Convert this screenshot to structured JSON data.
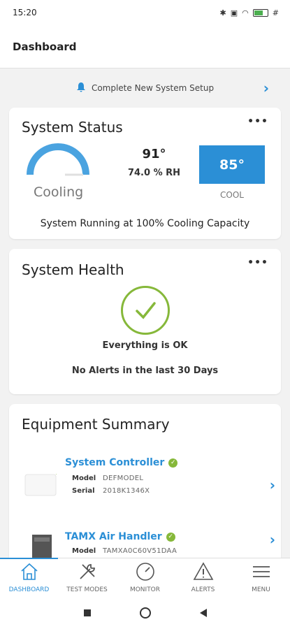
{
  "statusbar": {
    "time": "15:20",
    "battery": "86"
  },
  "appbar": {
    "title": "Dashboard"
  },
  "setup_banner": {
    "label": "Complete New System Setup"
  },
  "status_card": {
    "title": "System Status",
    "gauge_label": "Cooling",
    "indoor_temp": "91°",
    "humidity": "74.0 % RH",
    "setpoint": "85°",
    "mode": "COOL",
    "running_text": "System Running at 100% Cooling Capacity"
  },
  "health_card": {
    "title": "System Health",
    "status": "Everything is OK",
    "alerts": "No Alerts in the last 30 Days"
  },
  "equipment_card": {
    "title": "Equipment Summary",
    "items": [
      {
        "name": "System Controller",
        "model_label": "Model",
        "model": "DEFMODEL",
        "serial_label": "Serial",
        "serial": "2018K1346X"
      },
      {
        "name": "TAMX Air Handler",
        "model_label": "Model",
        "model": "TAMXA0C60V51DAA"
      }
    ]
  },
  "bottom_nav": {
    "tabs": [
      {
        "label": "DASHBOARD",
        "icon": "home-icon"
      },
      {
        "label": "TEST MODES",
        "icon": "tools-icon"
      },
      {
        "label": "MONITOR",
        "icon": "gauge-icon"
      },
      {
        "label": "ALERTS",
        "icon": "alert-icon"
      },
      {
        "label": "MENU",
        "icon": "menu-icon"
      }
    ]
  },
  "colors": {
    "accent": "#2b8fd6",
    "ok": "#86b83a"
  }
}
